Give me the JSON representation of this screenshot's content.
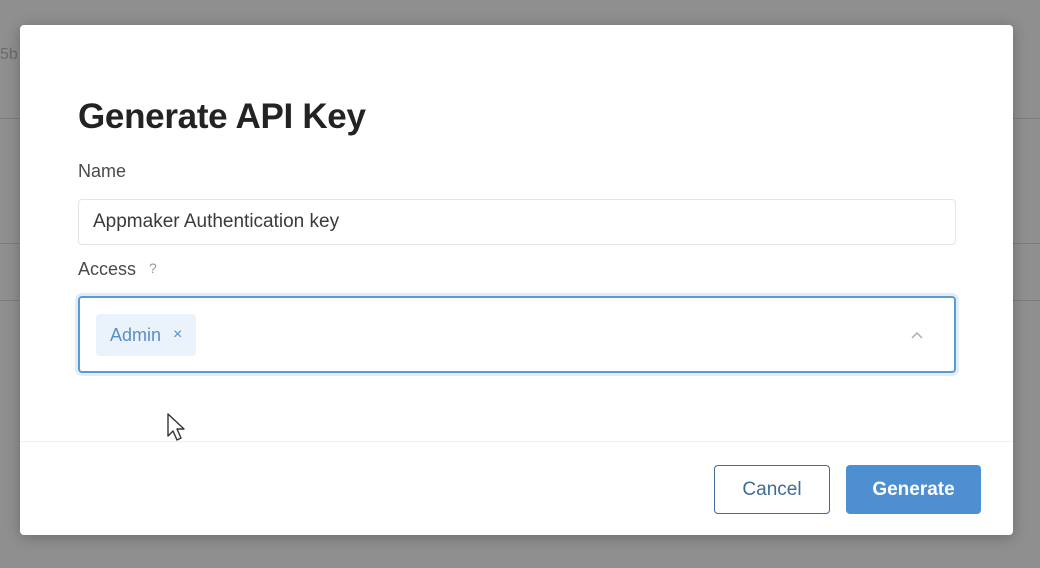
{
  "backdrop": {
    "partial_text": "5b"
  },
  "modal": {
    "title": "Generate API Key",
    "name_label": "Name",
    "name_value": "Appmaker Authentication key",
    "access_label": "Access",
    "access_help": "?",
    "access_tags": [
      {
        "label": "Admin",
        "remove": "×"
      }
    ],
    "cancel_label": "Cancel",
    "generate_label": "Generate"
  },
  "colors": {
    "accent": "#4e8fd1",
    "focus_border": "#5b9bd5",
    "tag_bg": "#eaf2fb",
    "cancel_border": "#3d6d98"
  },
  "icons": {
    "help": "question-mark-icon",
    "tag_remove": "close-icon",
    "select_toggle": "chevron-up-icon",
    "pointer": "mouse-cursor-icon"
  }
}
